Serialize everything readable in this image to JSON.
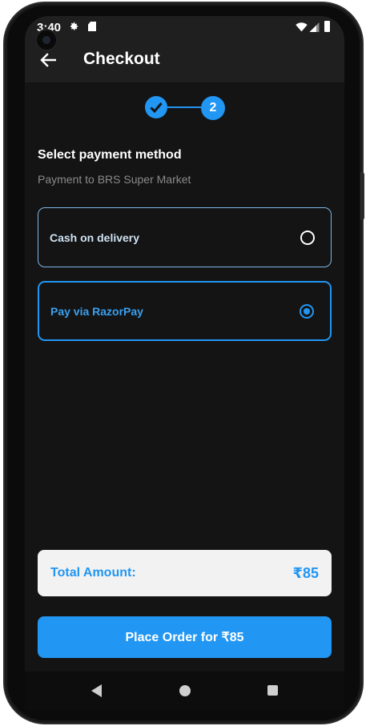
{
  "status_bar": {
    "time": "3:40"
  },
  "header": {
    "title": "Checkout"
  },
  "stepper": {
    "current_step": "2"
  },
  "payment": {
    "title": "Select payment method",
    "subtitle": "Payment to BRS Super Market",
    "options": [
      {
        "label": "Cash on delivery",
        "selected": false
      },
      {
        "label": "Pay via RazorPay",
        "selected": true
      }
    ]
  },
  "total": {
    "label": "Total Amount:",
    "value": "₹85"
  },
  "actions": {
    "place_order_label": "Place Order for ₹85"
  },
  "colors": {
    "accent": "#2196f3",
    "background": "#141414",
    "appbar": "#1f1f1f"
  },
  "icons": [
    "back-arrow-icon",
    "check-icon",
    "gear-icon",
    "sd-card-icon",
    "wifi-icon",
    "signal-icon",
    "battery-icon",
    "nav-back-icon",
    "nav-home-icon",
    "nav-recent-icon"
  ]
}
